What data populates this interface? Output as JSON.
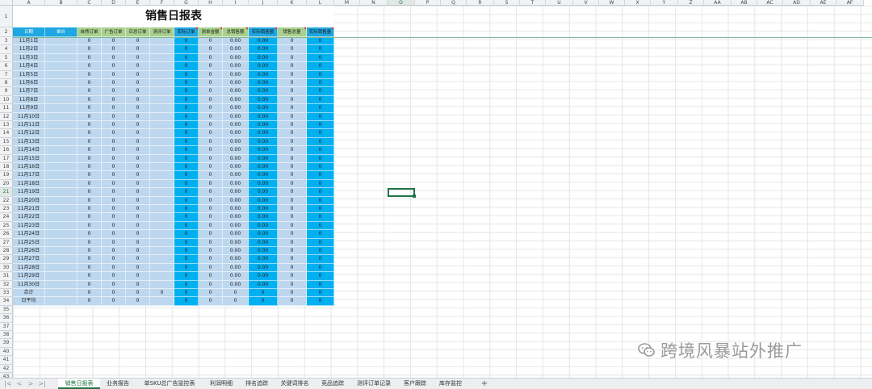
{
  "sheet": {
    "title": "销售日报表",
    "col_letters": [
      "A",
      "B",
      "C",
      "D",
      "E",
      "F",
      "G",
      "H",
      "I",
      "J",
      "K",
      "L",
      "M",
      "N",
      "O",
      "P",
      "Q",
      "R",
      "S",
      "T",
      "U",
      "V",
      "W",
      "X",
      "Y",
      "Z",
      "AA",
      "AB",
      "AC",
      "AD",
      "AE",
      "AF"
    ],
    "selected_col": "O",
    "selected_row": "21",
    "headers": [
      "日期",
      "单价",
      "自然订单",
      "广告订单",
      "日总订单",
      "测评订单",
      "实际订单",
      "测单金额",
      "总销售额",
      "实际销售额",
      "销售总量",
      "实际销售量"
    ],
    "dates": [
      "11月1日",
      "11月2日",
      "11月3日",
      "11月4日",
      "11月5日",
      "11月6日",
      "11月7日",
      "11月8日",
      "11月9日",
      "11月10日",
      "11月11日",
      "11月12日",
      "11月13日",
      "11月14日",
      "11月15日",
      "11月16日",
      "11月17日",
      "11月18日",
      "11月19日",
      "11月20日",
      "11月21日",
      "11月22日",
      "11月23日",
      "11月24日",
      "11月25日",
      "11月26日",
      "11月27日",
      "11月28日",
      "11月29日",
      "11月30日"
    ],
    "daily_row": [
      "",
      "0",
      "0",
      "0",
      "",
      "0",
      "0",
      "0.00",
      "0.00",
      "0",
      "0"
    ],
    "total_label": "合计",
    "total_row": [
      "",
      "0",
      "0",
      "0",
      "0",
      "0",
      "0",
      "0",
      "0",
      "0",
      "0"
    ],
    "avg_label": "日平均",
    "avg_row": [
      "",
      "0",
      "0",
      "0",
      "",
      "0",
      "0",
      "0",
      "0",
      "0",
      "0"
    ]
  },
  "tabs": [
    "销售日报表",
    "业务报告",
    "单SKU总广告监控表",
    "利润明细",
    "排名追踪",
    "关键词排名",
    "竞品追踪",
    "测评订单记录",
    "客户跟踪",
    "库存监控"
  ],
  "active_tab": 0,
  "nav": {
    "first": "|<",
    "prev": "<",
    "next": ">",
    "last": ">|",
    "add": "+"
  },
  "watermark": "跨境风暴站外推广",
  "colors": {
    "header_green": "#a9d08e",
    "header_blue": "#1ea7e1",
    "body_blue": "#bdd7ee",
    "body_cyan": "#00b0f0",
    "accent": "#217346"
  }
}
